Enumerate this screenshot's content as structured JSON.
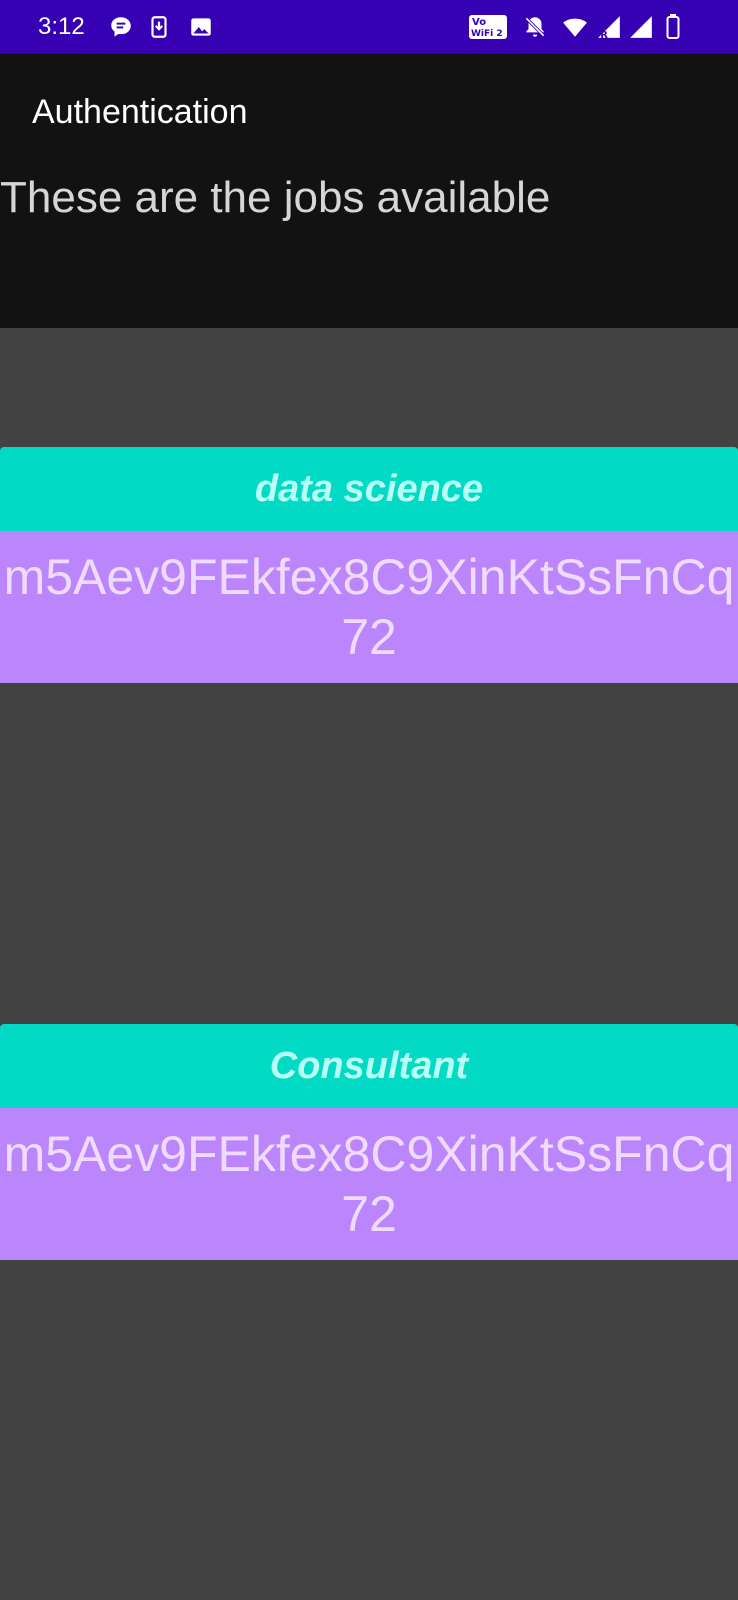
{
  "status_bar": {
    "time": "3:12",
    "left_icons": [
      "chat-bubble-icon",
      "download-icon",
      "image-icon"
    ],
    "right_icons": [
      "vowifi-icon",
      "notifications-off-icon",
      "wifi-icon",
      "signal-roaming-icon",
      "signal-icon",
      "battery-icon"
    ],
    "vowifi_label_top": "Vo",
    "vowifi_label_bottom": "WiFi 2"
  },
  "app_bar": {
    "title": "Authentication"
  },
  "header": {
    "subtitle": "These are the jobs available"
  },
  "jobs": [
    {
      "title": "data science",
      "id": "m5Aev9FEkfex8C9XinKtSsFnCq72"
    },
    {
      "title": "Consultant",
      "id": "m5Aev9FEkfex8C9XinKtSsFnCq72"
    }
  ],
  "colors": {
    "status_bar": "#3700b3",
    "app_bar": "#121212",
    "background": "#424242",
    "card_title_bg": "#03dac5",
    "card_title_text": "#b9fff3",
    "card_body_bg": "#bb86fc",
    "card_body_text": "#f0dbff"
  }
}
